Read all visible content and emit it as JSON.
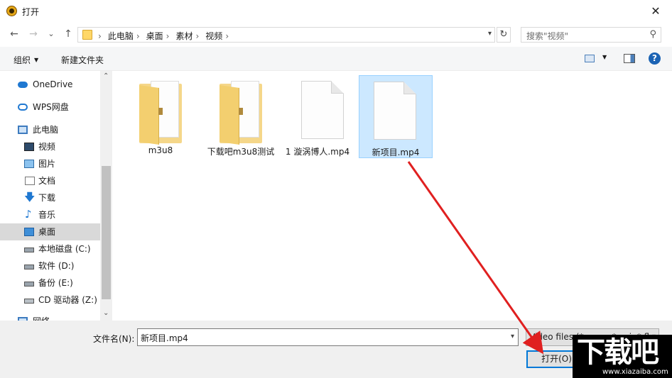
{
  "window": {
    "title": "打开",
    "close_glyph": "✕"
  },
  "nav": {
    "back_glyph": "←",
    "forward_glyph": "→",
    "recent_glyph": "⌄",
    "up_glyph": "↑",
    "breadcrumbs": [
      "此电脑",
      "桌面",
      "素材",
      "视频"
    ],
    "separator": "›",
    "refresh_glyph": "↻",
    "search_placeholder": "搜索\"视频\"",
    "search_glyph": "⚲"
  },
  "toolbar": {
    "organize": "组织",
    "new_folder": "新建文件夹",
    "help": "?"
  },
  "sidebar": {
    "items": [
      {
        "label": "OneDrive",
        "icon": "onedrive-icon"
      },
      {
        "label": "WPS网盘",
        "icon": "wps-cloud-icon"
      },
      {
        "label": "此电脑",
        "icon": "computer-icon"
      },
      {
        "label": "视频",
        "icon": "video-folder-icon"
      },
      {
        "label": "图片",
        "icon": "pictures-folder-icon"
      },
      {
        "label": "文档",
        "icon": "documents-folder-icon"
      },
      {
        "label": "下载",
        "icon": "download-folder-icon"
      },
      {
        "label": "音乐",
        "icon": "music-folder-icon"
      },
      {
        "label": "桌面",
        "icon": "desktop-folder-icon",
        "selected": true
      },
      {
        "label": "本地磁盘 (C:)",
        "icon": "drive-icon"
      },
      {
        "label": "软件 (D:)",
        "icon": "drive-icon"
      },
      {
        "label": "备份 (E:)",
        "icon": "drive-icon"
      },
      {
        "label": "CD 驱动器 (Z:)",
        "icon": "cd-drive-icon"
      },
      {
        "label": "网络",
        "icon": "network-icon"
      }
    ]
  },
  "files": [
    {
      "name": "m3u8",
      "type": "folder"
    },
    {
      "name": "下载吧m3u8测试",
      "type": "folder"
    },
    {
      "name": "1 漩涡博人.mp4",
      "type": "file"
    },
    {
      "name": "新项目.mp4",
      "type": "file",
      "selected": true
    }
  ],
  "bottom": {
    "filename_label": "文件名(N):",
    "filename_value": "新项目.mp4",
    "filetype_value": "Video files (*.wmv, *.avi, *.flv",
    "open_label": "打开(O)"
  },
  "watermark": {
    "big": "下载吧",
    "small": "www.xiazaiba.com"
  },
  "colors": {
    "selection": "#cce8ff",
    "accent": "#0078d7",
    "arrow": "#e02020"
  }
}
